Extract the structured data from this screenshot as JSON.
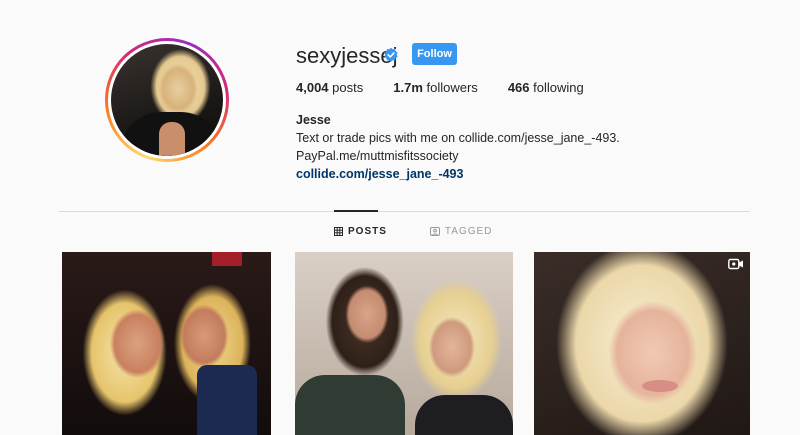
{
  "profile": {
    "username": "sexyjessej",
    "verified_icon": "verified-badge-icon",
    "follow_label": "Follow",
    "stats": {
      "posts_count": "4,004",
      "posts_label": "posts",
      "followers_count": "1.7m",
      "followers_label": "followers",
      "following_count": "466",
      "following_label": "following"
    },
    "bio": {
      "name": "Jesse",
      "line1": "Text or trade pics with me on collide.com/jesse_jane_-493.",
      "line2": "PayPal.me/muttmisfitssociety",
      "link": "collide.com/jesse_jane_-493"
    }
  },
  "tabs": [
    {
      "label": "POSTS",
      "icon": "grid-icon",
      "active": true
    },
    {
      "label": "TAGGED",
      "icon": "tag-icon",
      "active": false
    }
  ],
  "posts": [
    {
      "icon": null
    },
    {
      "icon": null
    },
    {
      "icon": "video-camera-icon"
    }
  ],
  "colors": {
    "accent": "#3897f0",
    "link": "#003569",
    "text": "#262626",
    "background": "#fafafa"
  }
}
